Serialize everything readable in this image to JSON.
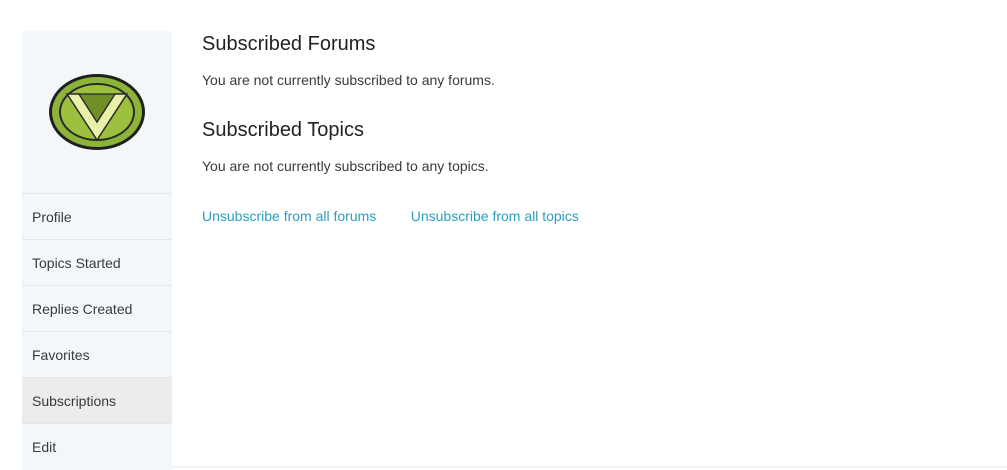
{
  "sidebar": {
    "avatar_alt": "avatar",
    "items": [
      {
        "label": "Profile",
        "active": false
      },
      {
        "label": "Topics Started",
        "active": false
      },
      {
        "label": "Replies Created",
        "active": false
      },
      {
        "label": "Favorites",
        "active": false
      },
      {
        "label": "Subscriptions",
        "active": true
      },
      {
        "label": "Edit",
        "active": false
      }
    ]
  },
  "main": {
    "forums": {
      "title": "Subscribed Forums",
      "text": "You are not currently subscribed to any forums."
    },
    "topics": {
      "title": "Subscribed Topics",
      "text": "You are not currently subscribed to any topics."
    },
    "links": {
      "unsubscribe_forums": "Unsubscribe from all forums",
      "unsubscribe_topics": "Unsubscribe from all topics"
    }
  },
  "colors": {
    "sidebar_bg": "#f3f7fa",
    "active_item_bg": "#ececec",
    "link": "#2a9fc4",
    "avatar_green": "#8cb33a",
    "avatar_dark": "#5b7d1f"
  }
}
